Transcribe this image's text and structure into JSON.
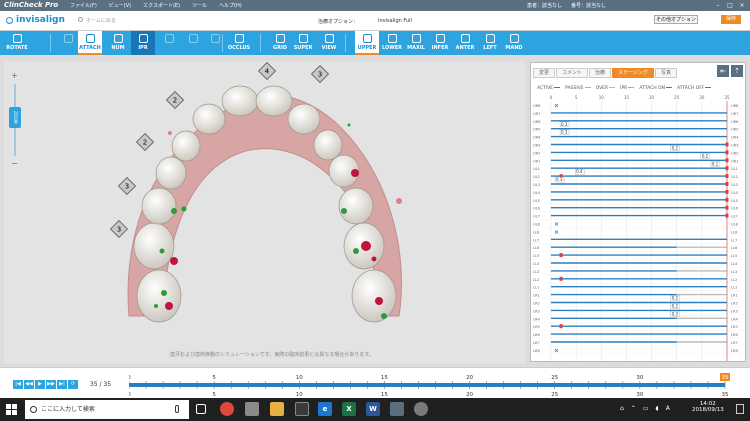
{
  "window": {
    "app": "ClinCheck Pro",
    "menus": [
      "ファイル(F)",
      "ビュー(V)",
      "エクスポート(E)",
      "ツール",
      "ヘルプ(H)"
    ],
    "patient_label": "患者：",
    "patient_value": "該当なし",
    "number_label": "番号：",
    "number_value": "該当なし"
  },
  "header": {
    "logo": "invisalign",
    "home": "ホームに戻る",
    "plan_label": "治療オプション：",
    "plan_value": "Invisalign Full",
    "other_options": "その他オプション",
    "save": "保存"
  },
  "toolbar": [
    {
      "label": "ROTATE",
      "state": "normal"
    },
    {
      "label": "",
      "state": "disabled"
    },
    {
      "label": "ATTACH",
      "state": "active"
    },
    {
      "label": "NUM",
      "state": "normal"
    },
    {
      "label": "IPR",
      "state": "active-dark"
    },
    {
      "label": "",
      "state": "disabled"
    },
    {
      "label": "",
      "state": "disabled"
    },
    {
      "label": "",
      "state": "disabled"
    },
    {
      "label": "OCCLUS",
      "state": "normal"
    },
    {
      "label": "GRID",
      "state": "normal"
    },
    {
      "label": "SUPER",
      "state": "normal"
    },
    {
      "label": "VIEW",
      "state": "normal"
    },
    {
      "label": "UPPER",
      "state": "active"
    },
    {
      "label": "LOWER",
      "state": "normal"
    },
    {
      "label": "MAXIL",
      "state": "normal"
    },
    {
      "label": "INFER",
      "state": "normal"
    },
    {
      "label": "ANTER",
      "state": "normal"
    },
    {
      "label": "LEFT",
      "state": "normal"
    },
    {
      "label": "MAND",
      "state": "normal"
    }
  ],
  "zoom_label": "ZOOM",
  "ipr_markers": [
    "3",
    "3",
    "2",
    "2",
    "4",
    "3"
  ],
  "simulation_note": "歯牙および歯肉移動のシミュレーションです。実際の臨床結果とは異なる場合があります。",
  "panel": {
    "tabs": [
      "変更",
      "コメント",
      "治療",
      "ステージング",
      "写真"
    ],
    "active_tab": "ステージング",
    "legend": [
      "ACTIVE",
      "PASSIVE",
      "OVER",
      "IPR",
      "ATTACH ON",
      "ATTACH OFF"
    ]
  },
  "staging": {
    "ticks": [
      "0",
      "5",
      "10",
      "15",
      "20",
      "25",
      "30",
      "35"
    ],
    "teeth": [
      "UR8",
      "UR7",
      "UR6",
      "UR5",
      "UR4",
      "UR3",
      "UR2",
      "UR1",
      "UL1",
      "UL2",
      "UL3",
      "UL4",
      "UL5",
      "UL6",
      "UL7",
      "UL8",
      "LL8",
      "LL7",
      "LL6",
      "LL5",
      "LL4",
      "LL3",
      "LL2",
      "LL1",
      "LR1",
      "LR2",
      "LR3",
      "LR4",
      "LR5",
      "LR6",
      "LR7",
      "LR8"
    ],
    "ipr_labels": [
      {
        "row": 2,
        "stage": 2,
        "text": "0.3"
      },
      {
        "row": 3,
        "stage": 2,
        "text": "0.3"
      },
      {
        "row": 5,
        "stage": 24,
        "text": "0.2"
      },
      {
        "row": 6,
        "stage": 30,
        "text": "0.2"
      },
      {
        "row": 7,
        "stage": 32,
        "text": "0.1"
      },
      {
        "row": 8,
        "stage": 5,
        "text": "0.4"
      },
      {
        "row": 9,
        "stage": 1,
        "text": "0.3"
      },
      {
        "row": 24,
        "stage": 24,
        "text": "0.2"
      },
      {
        "row": 25,
        "stage": 24,
        "text": "0.2"
      },
      {
        "row": 26,
        "stage": 24,
        "text": "0.3"
      }
    ]
  },
  "playback": {
    "position": "35 / 35",
    "current": "35"
  },
  "taskbar": {
    "search": "ここに入力して検索",
    "time": "14:02",
    "date": "2018/09/13"
  }
}
